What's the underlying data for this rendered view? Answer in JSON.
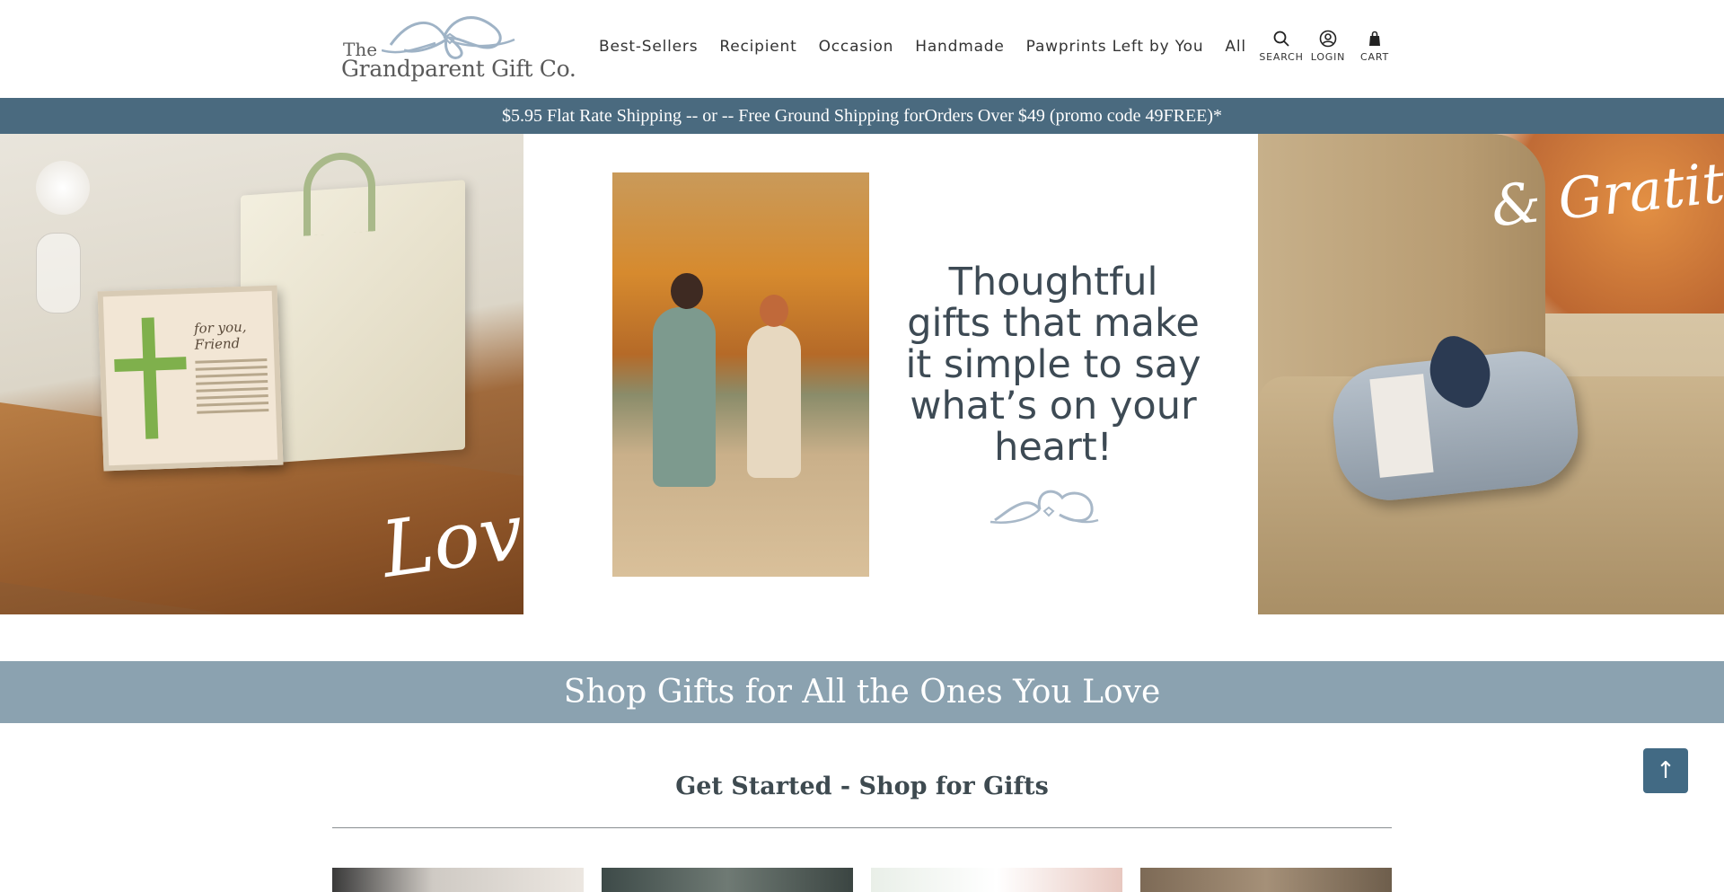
{
  "header": {
    "logo": {
      "line1": "The",
      "line2": "Grandparent Gift Co."
    },
    "nav": [
      {
        "label": "Best-Sellers"
      },
      {
        "label": "Recipient"
      },
      {
        "label": "Occasion"
      },
      {
        "label": "Handmade"
      },
      {
        "label": "Pawprints Left by You"
      },
      {
        "label": "All"
      }
    ],
    "icons": {
      "search": {
        "label": "SEARCH",
        "icon": "search-icon"
      },
      "login": {
        "label": "LOGIN",
        "icon": "user-icon"
      },
      "cart": {
        "label": "CART",
        "icon": "bag-icon"
      }
    }
  },
  "shipping_bar": {
    "text": "$5.95 Flat Rate Shipping -- or -- Free Ground Shipping forOrders Over $49 (promo code 49FREE)*"
  },
  "hero": {
    "left_script": "Love",
    "right_script": "& Gratitude",
    "card_title": "for you, Friend",
    "tagline": "Thoughtful gifts that make it simple to say what’s on your heart!"
  },
  "shop_band": {
    "title": "Shop Gifts for All the Ones You Love"
  },
  "get_started": {
    "title": "Get Started - Shop for Gifts"
  },
  "back_to_top": {
    "label": "↑",
    "icon": "arrow-up-icon"
  },
  "colors": {
    "shipping_bar_bg": "#4a6a7f",
    "shop_band_bg": "#8ba2b0",
    "back_to_top_bg": "#426a84"
  }
}
